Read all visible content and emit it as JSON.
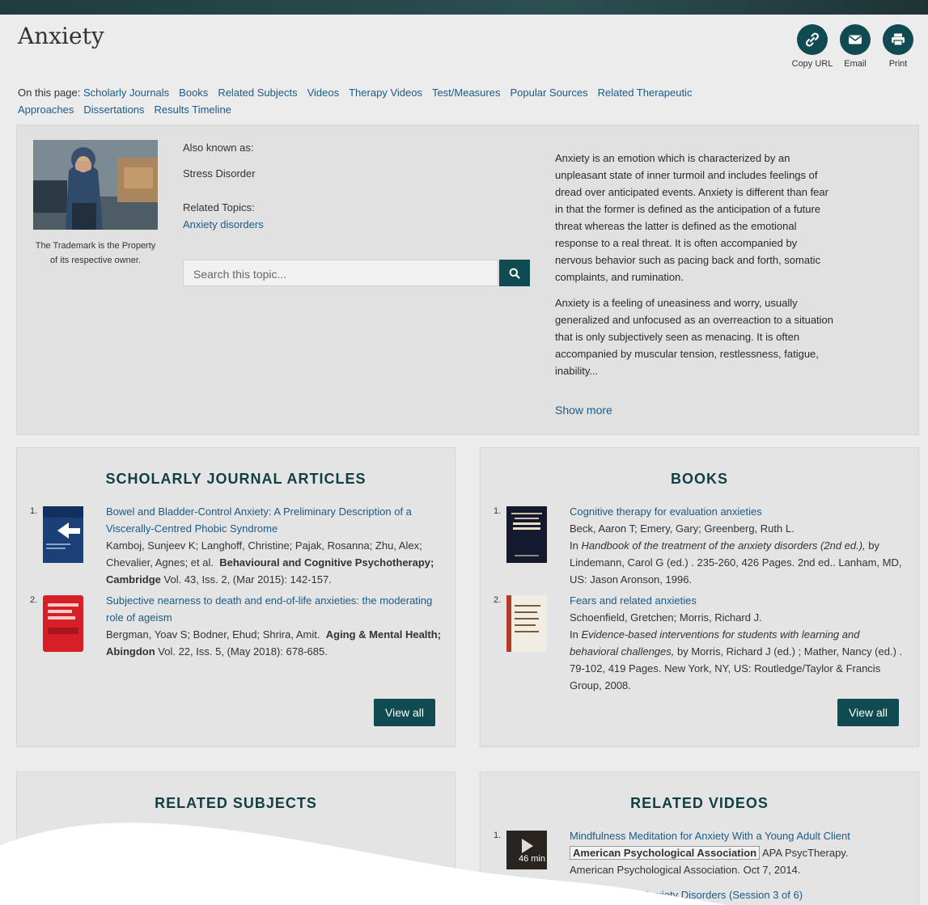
{
  "page": {
    "title": "Anxiety"
  },
  "share": {
    "copy_url_label": "Copy URL",
    "email_label": "Email",
    "print_label": "Print"
  },
  "on_this_page": {
    "label": "On this page:",
    "links": [
      "Scholarly Journals",
      "Books",
      "Related Subjects",
      "Videos",
      "Therapy Videos",
      "Test/Measures",
      "Popular Sources",
      "Related Therapeutic Approaches",
      "Dissertations",
      "Results Timeline"
    ]
  },
  "topic": {
    "image_caption": "The Trademark is the Property of its respective owner.",
    "also_known_as_label": "Also known as:",
    "also_known_as": "Stress Disorder",
    "related_topics_label": "Related Topics:",
    "related_topics": "Anxiety disorders",
    "search_placeholder": "Search this topic...",
    "description_1": "Anxiety is an emotion which is characterized by an unpleasant state of inner turmoil and includes feelings of dread over anticipated events. Anxiety is different than fear in that the former is defined as the anticipation of a future threat whereas the latter is defined as the emotional response to a real threat. It is often accompanied by nervous behavior such as pacing back and forth, somatic complaints, and rumination.",
    "description_2": "Anxiety is a feeling of uneasiness and worry, usually generalized and unfocused as an overreaction to a situation that is only subjectively seen as menacing. It is often accompanied by muscular tension, restlessness, fatigue, inability...",
    "show_more": "Show more"
  },
  "journals": {
    "title": "SCHOLARLY JOURNAL ARTICLES",
    "view_all": "View all",
    "items": [
      {
        "num": "1.",
        "title": "Bowel and Bladder-Control Anxiety: A Preliminary Description of a Viscerally-Centred Phobic Syndrome",
        "authors": "Kamboj, Sunjeev K; Langhoff, Christine; Pajak, Rosanna; Zhu, Alex; Chevalier, Agnes; et al.",
        "source": "Behavioural and Cognitive Psychotherapy; Cambridge",
        "details": "Vol. 43, Iss. 2,  (Mar 2015): 142-157."
      },
      {
        "num": "2.",
        "title": "Subjective nearness to death and end-of-life anxieties: the moderating role of ageism",
        "authors": "Bergman, Yoav S; Bodner, Ehud; Shrira, Amit.",
        "source": "Aging & Mental Health; Abingdon",
        "details": "Vol. 22, Iss. 5,  (May 2018): 678-685."
      }
    ]
  },
  "books": {
    "title": "BOOKS",
    "view_all": "View all",
    "items": [
      {
        "num": "1.",
        "title": "Cognitive therapy for evaluation anxieties",
        "authors": "Beck, Aaron T; Emery, Gary; Greenberg, Ruth L.",
        "in_prefix": "In",
        "in_title": "Handbook of the treatment of the anxiety disorders (2nd ed.),",
        "rest": "by Lindemann, Carol G (ed.) .  235-260, 426 Pages. 2nd ed.. Lanham, MD, US: Jason Aronson, 1996."
      },
      {
        "num": "2.",
        "title": "Fears and related anxieties",
        "authors": "Schoenfield, Gretchen; Morris, Richard J.",
        "in_prefix": "In",
        "in_title": "Evidence-based interventions for students with learning and behavioral challenges,",
        "rest": "by Morris, Richard J (ed.) ; Mather, Nancy (ed.) .  79-102, 419 Pages. New York, NY, US: Routledge/Taylor & Francis Group, 2008."
      }
    ]
  },
  "related_subjects": {
    "title": "RELATED SUBJECTS"
  },
  "related_videos": {
    "title": "RELATED VIDEOS",
    "items": [
      {
        "num": "1.",
        "duration": "46 min",
        "title": "Mindfulness Meditation for Anxiety With a Young Adult Client",
        "publisher_badge": "American Psychological Association",
        "series": "APA PsycTherapy.",
        "meta": "American Psychological Association. Oct 7, 2014."
      },
      {
        "title_partial": "ure Therapy for Anxiety Disorders (Session 3 of 6)"
      }
    ]
  }
}
